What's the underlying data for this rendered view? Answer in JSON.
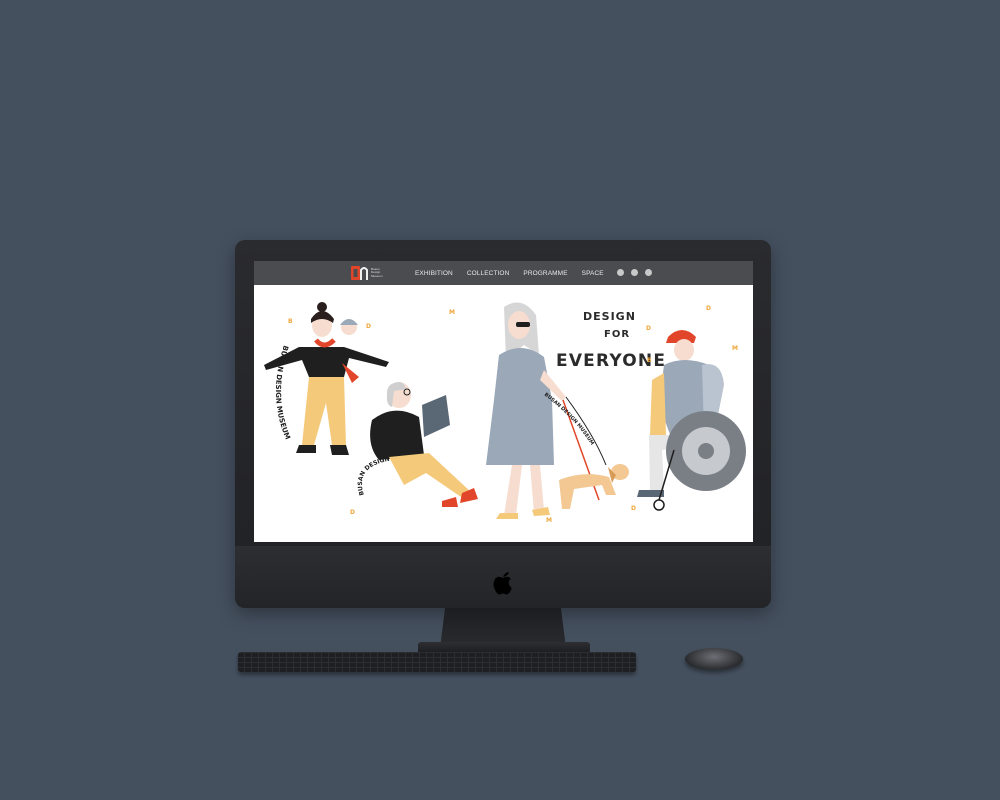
{
  "site": {
    "logo_lines": [
      "Busan",
      "Design",
      "Museum"
    ],
    "nav": {
      "items": [
        {
          "label": "EXHIBITION"
        },
        {
          "label": "COLLECTION"
        },
        {
          "label": "PROGRAMME"
        },
        {
          "label": "SPACE"
        }
      ],
      "icons": [
        "language-icon",
        "login-icon",
        "user-icon"
      ]
    },
    "hero": {
      "title_line1": "DESIGN",
      "title_line2": "FOR",
      "title_line3": "EVERYONE",
      "curved_text": "BUSAN DESIGN MUSEUM",
      "scatter_letters": [
        "B",
        "D",
        "M",
        "D",
        "D",
        "B",
        "M",
        "D",
        "M",
        "D"
      ]
    }
  },
  "colors": {
    "background": "#45505f",
    "nav_bar": "#4b4c50",
    "brand_red": "#e2462a",
    "accent_yellow": "#f5c97a",
    "accent_orange": "#f0a63a",
    "figure_grey": "#9aa8b8"
  }
}
